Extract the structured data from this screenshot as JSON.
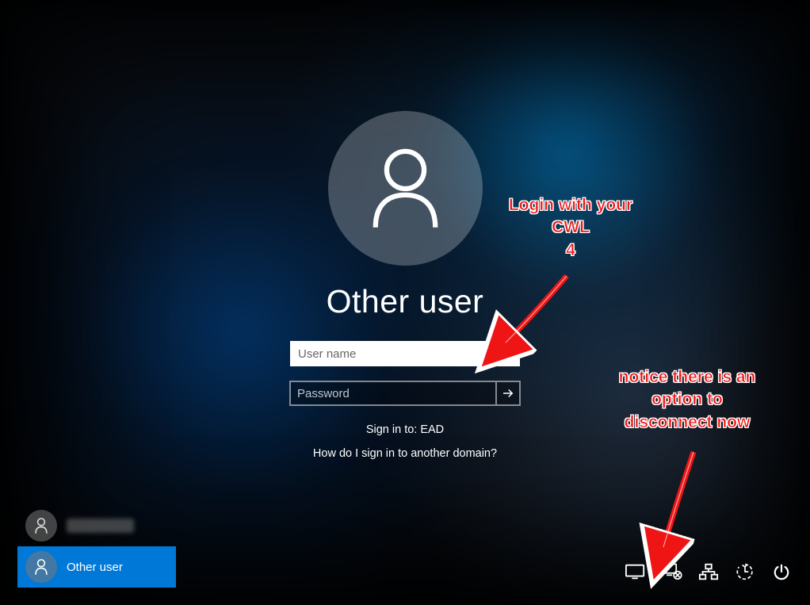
{
  "login": {
    "title": "Other user",
    "username_placeholder": "User name",
    "password_placeholder": "Password",
    "signin_to": "Sign in to: EAD",
    "domain_hint": "How do I sign in to another domain?"
  },
  "userlist": {
    "items": [
      {
        "label": "",
        "obscured": true
      },
      {
        "label": "Other user",
        "selected": true
      }
    ]
  },
  "tray_icons": [
    "display-icon",
    "disconnect-icon",
    "network-icon",
    "ease-of-access-icon",
    "power-icon"
  ],
  "annotations": {
    "login_hint_line1": "Login with your",
    "login_hint_line2": "CWL",
    "login_hint_step": "4",
    "disconnect_hint_line1": "notice there is an",
    "disconnect_hint_line2": "option to",
    "disconnect_hint_line3": "disconnect now"
  }
}
